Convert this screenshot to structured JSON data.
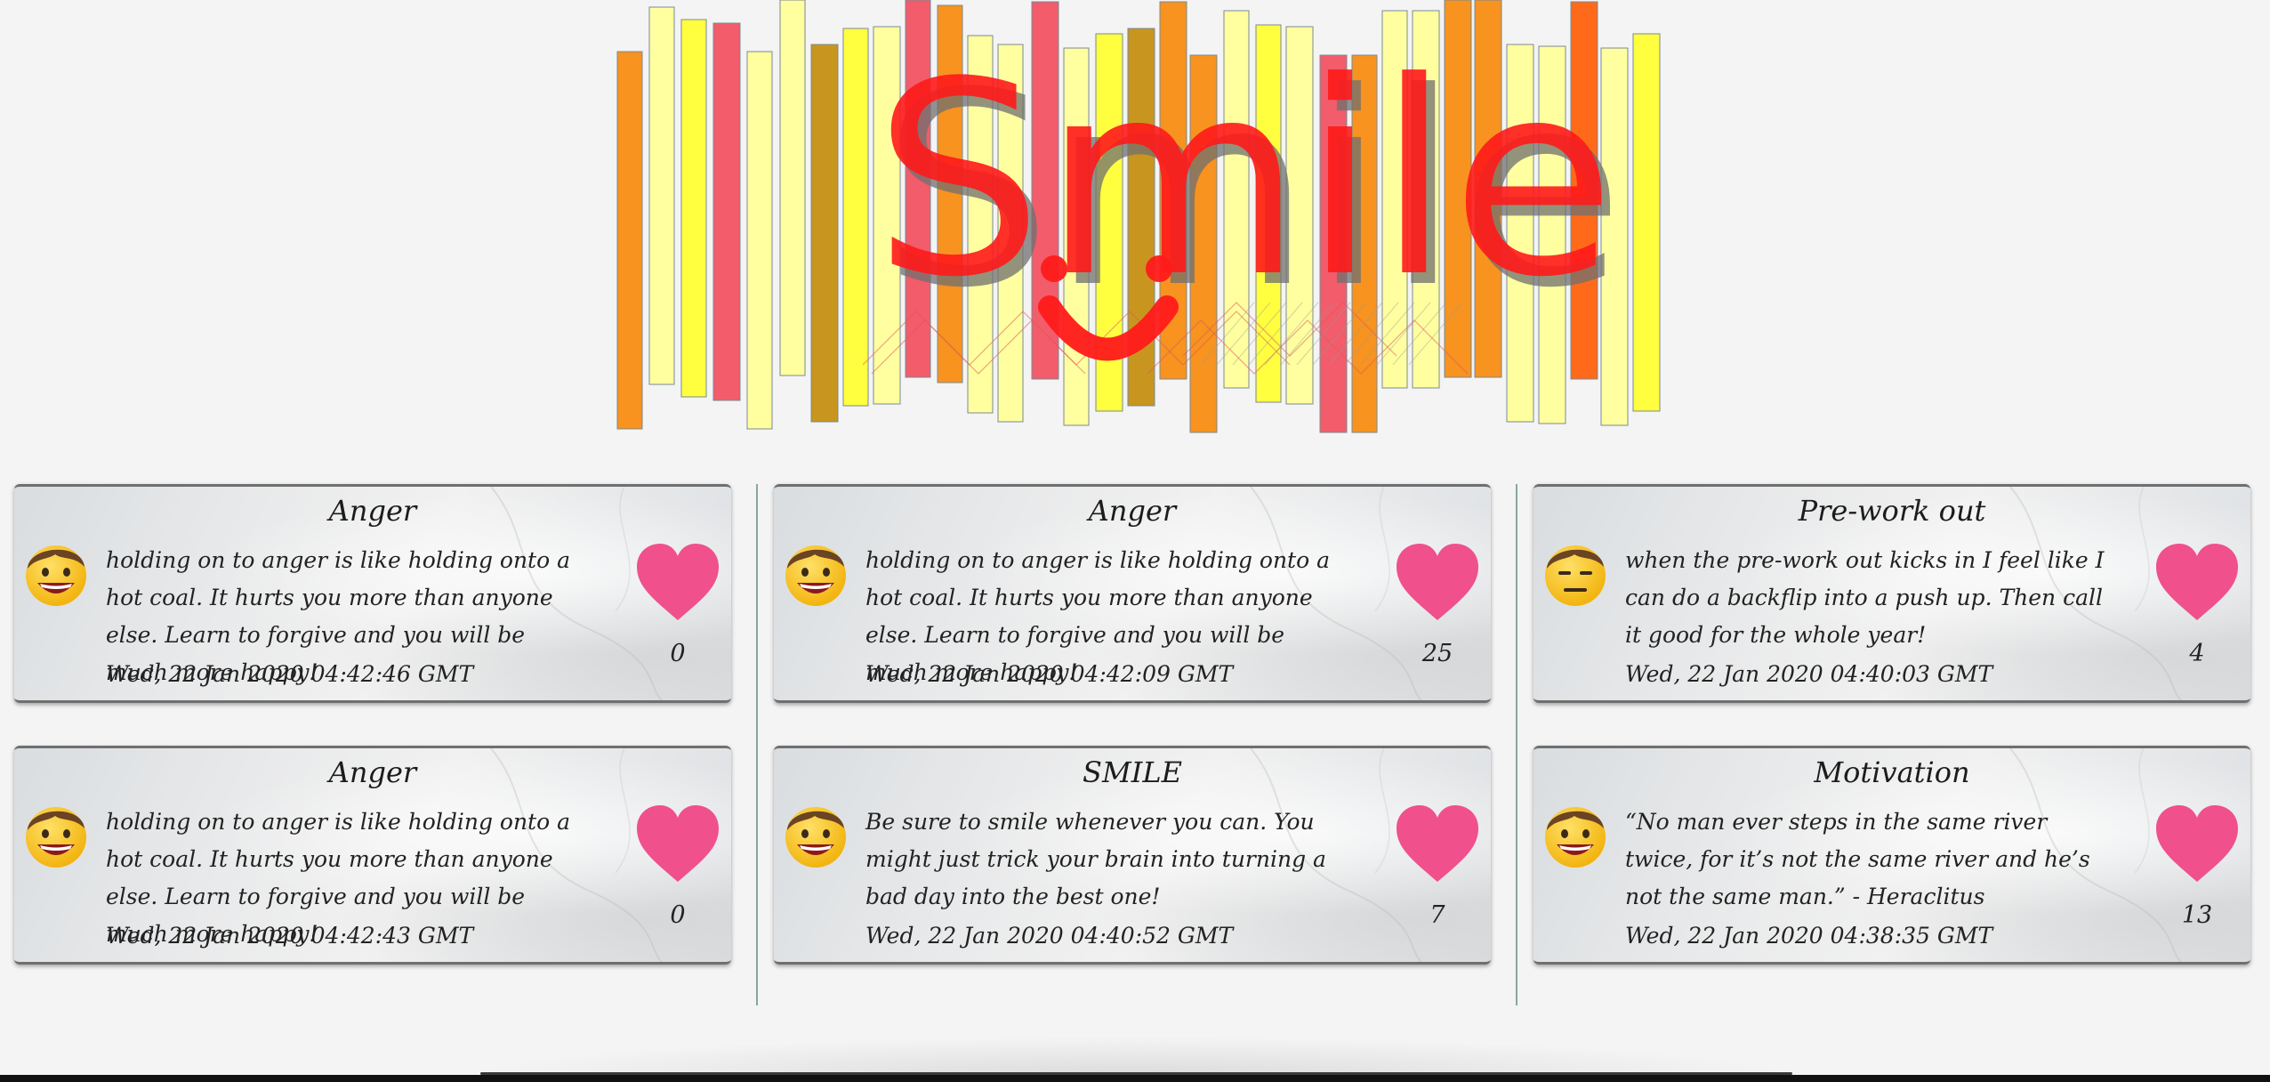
{
  "header": {
    "logo_text": "Smile",
    "colors": {
      "orange": "#f7931e",
      "dark_orange": "#ff6a1a",
      "pale_yellow": "#ffffa0",
      "yellow": "#ffff40",
      "gold": "#c8961e",
      "pink_red": "#f25c6b",
      "red": "#ff1a1a"
    }
  },
  "cards": [
    {
      "title": "Anger",
      "avatar": "grinning-face-emoji",
      "body": "holding on to anger is like holding onto a hot coal. It hurts you more than anyone else. Learn to forgive and you will be much more happy!",
      "date": "Wed, 22 Jan 2020 04:42:46 GMT",
      "likes": "0"
    },
    {
      "title": "Anger",
      "avatar": "grinning-face-emoji",
      "body": "holding on to anger is like holding onto a hot coal. It hurts you more than anyone else. Learn to forgive and you will be much more happy!",
      "date": "Wed, 22 Jan 2020 04:42:09 GMT",
      "likes": "25"
    },
    {
      "title": "Pre-work out",
      "avatar": "neutral-face-emoji",
      "body": "when the pre-work out kicks in I feel like I can do a backflip into a push up. Then call it good for the whole year!",
      "date": "Wed, 22 Jan 2020 04:40:03 GMT",
      "likes": "4"
    },
    {
      "title": "Anger",
      "avatar": "grinning-face-emoji",
      "body": "holding on to anger is like holding onto a hot coal. It hurts you more than anyone else. Learn to forgive and you will be much more happy!",
      "date": "Wed, 22 Jan 2020 04:42:43 GMT",
      "likes": "0"
    },
    {
      "title": "SMILE",
      "avatar": "grinning-face-emoji",
      "body": "Be sure to smile whenever you can. You might just trick your brain into turning a bad day into the best one!",
      "date": "Wed, 22 Jan 2020 04:40:52 GMT",
      "likes": "7"
    },
    {
      "title": "Motivation",
      "avatar": "grinning-face-emoji",
      "body": "“No man ever steps in the same river twice, for it’s not the same river and he’s not the same man.” - Heraclitus",
      "date": "Wed, 22 Jan 2020 04:38:35 GMT",
      "likes": "13"
    }
  ],
  "theme": {
    "heart_color": "#f0508c",
    "divider_color": "#8aa6a0",
    "card_border": "#6f6f6f"
  }
}
